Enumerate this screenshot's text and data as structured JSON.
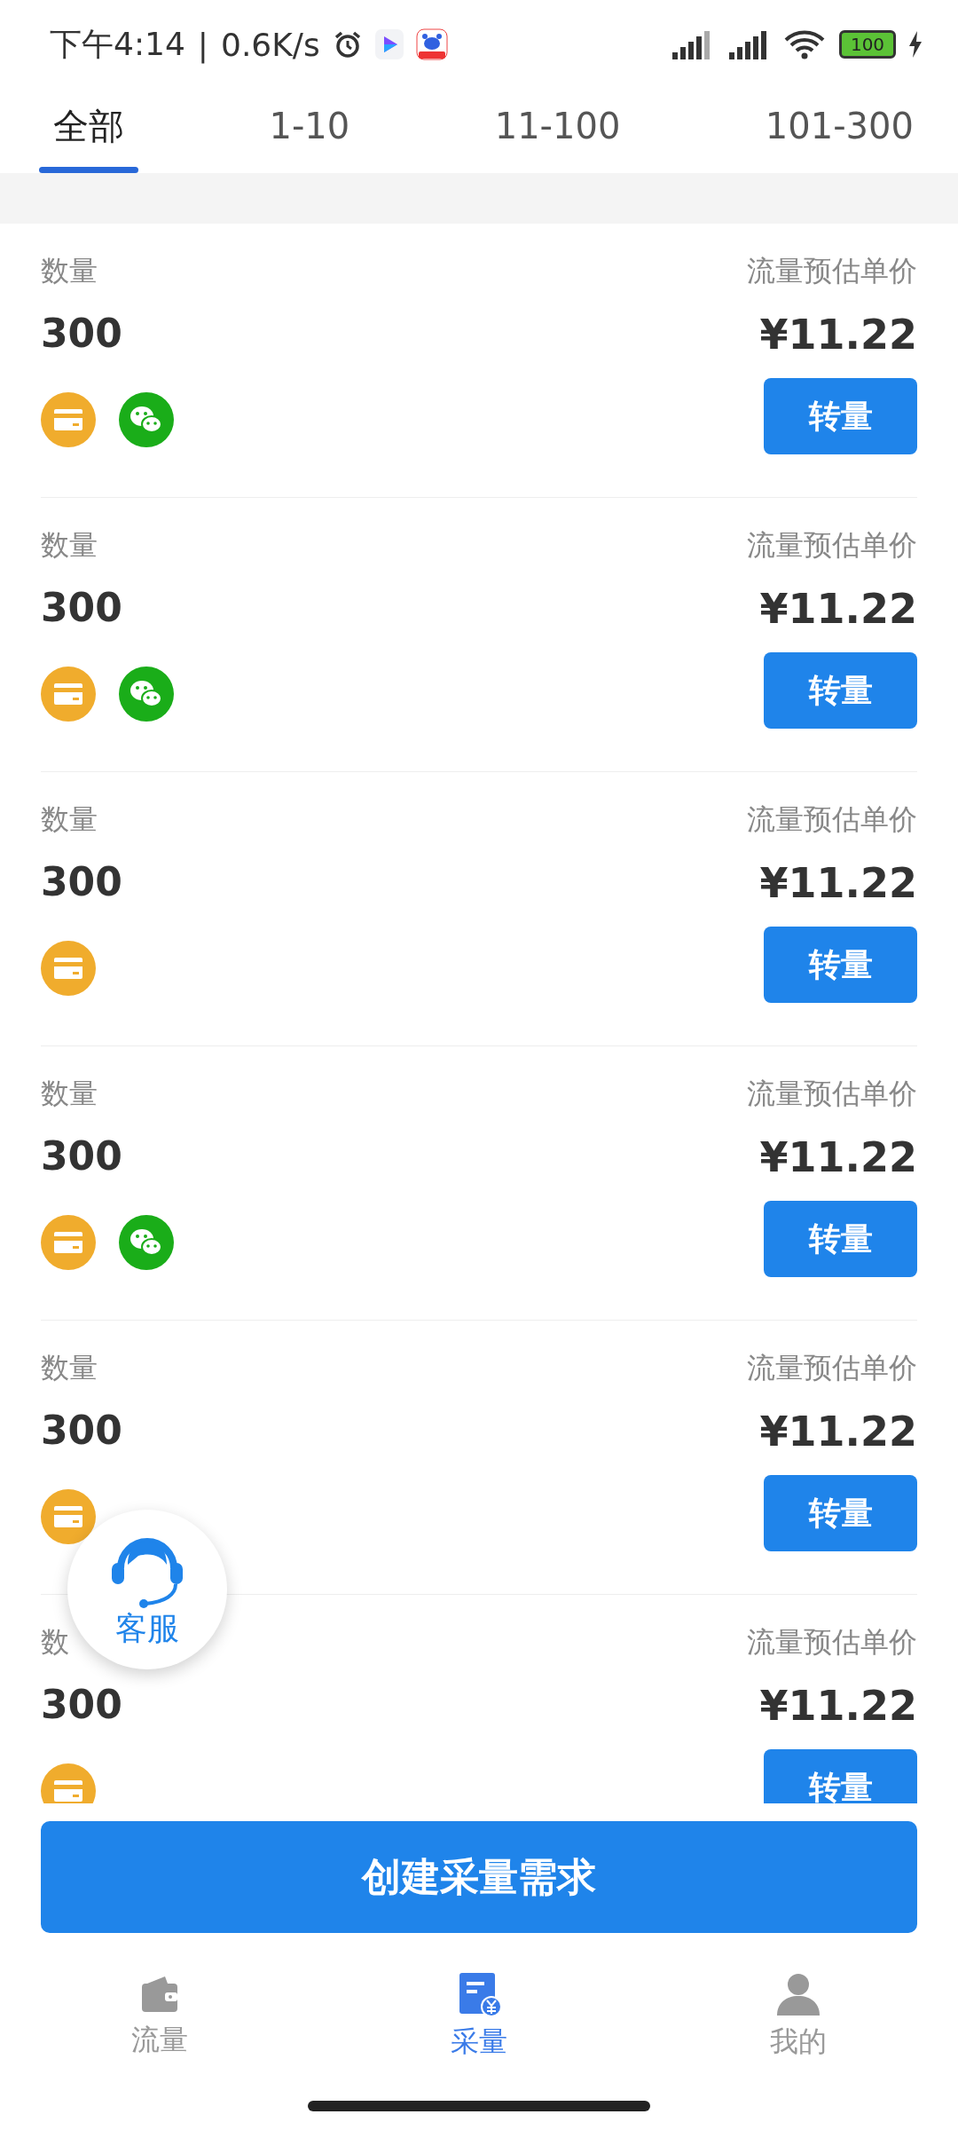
{
  "status_bar": {
    "time": "下午4:14",
    "separator": "|",
    "speed": "0.6K/s",
    "battery": "100"
  },
  "tabs": [
    {
      "label": "全部",
      "selected": true
    },
    {
      "label": "1-10",
      "selected": false
    },
    {
      "label": "11-100",
      "selected": false
    },
    {
      "label": "101-300",
      "selected": false
    }
  ],
  "offers": [
    {
      "quantity_label": "数量",
      "quantity": "300",
      "price_label": "流量预估单价",
      "price": "¥11.22",
      "button": "转量",
      "payments": [
        {
          "kind": "card"
        },
        {
          "kind": "wechat"
        }
      ]
    },
    {
      "quantity_label": "数量",
      "quantity": "300",
      "price_label": "流量预估单价",
      "price": "¥11.22",
      "button": "转量",
      "payments": [
        {
          "kind": "card"
        },
        {
          "kind": "wechat"
        }
      ]
    },
    {
      "quantity_label": "数量",
      "quantity": "300",
      "price_label": "流量预估单价",
      "price": "¥11.22",
      "button": "转量",
      "payments": [
        {
          "kind": "card"
        }
      ]
    },
    {
      "quantity_label": "数量",
      "quantity": "300",
      "price_label": "流量预估单价",
      "price": "¥11.22",
      "button": "转量",
      "payments": [
        {
          "kind": "card"
        },
        {
          "kind": "wechat"
        }
      ]
    },
    {
      "quantity_label": "数量",
      "quantity": "300",
      "price_label": "流量预估单价",
      "price": "¥11.22",
      "button": "转量",
      "payments": [
        {
          "kind": "card"
        }
      ]
    },
    {
      "quantity_label": "数",
      "quantity": "300",
      "price_label": "流量预估单价",
      "price": "¥11.22",
      "button": "转量",
      "payments": [
        {
          "kind": "card"
        }
      ]
    }
  ],
  "support_button": {
    "label": "客服"
  },
  "create_button": "创建采量需求",
  "bottom_nav": [
    {
      "label": "流量",
      "kind": "wallet",
      "selected": false
    },
    {
      "label": "采量",
      "kind": "bill",
      "selected": true
    },
    {
      "label": "我的",
      "kind": "person",
      "selected": false
    }
  ]
}
